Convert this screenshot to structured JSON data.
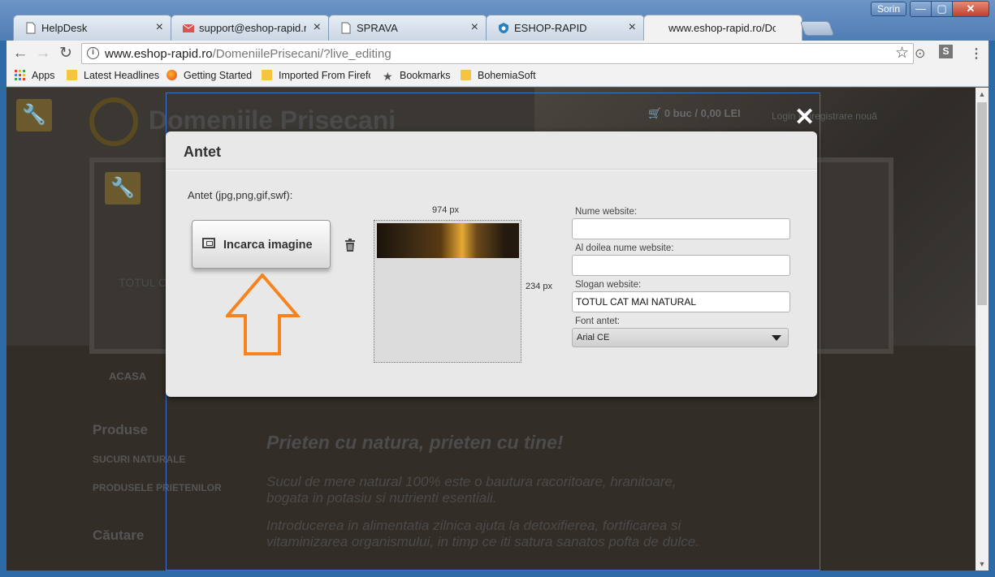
{
  "window": {
    "user": "Sorin",
    "min": "—",
    "max": "▢",
    "close": "✕"
  },
  "tabs": [
    {
      "title": "HelpDesk",
      "icon": "page-icon"
    },
    {
      "title": "support@eshop-rapid.ro",
      "icon": "mail-icon"
    },
    {
      "title": "SPRAVA",
      "icon": "page-icon"
    },
    {
      "title": "ESHOP-RAPID",
      "icon": "shield-icon"
    },
    {
      "title": "www.eshop-rapid.ro/Dom",
      "icon": "none",
      "active": true
    }
  ],
  "omnibox": {
    "domain": "www.eshop-rapid.ro",
    "path": "/DomeniilePrisecani/?live_editing"
  },
  "bookmarks": [
    {
      "label": "Apps",
      "icon": "apps-grid-icon"
    },
    {
      "label": "Latest Headlines",
      "icon": "folder-icon"
    },
    {
      "label": "Getting Started",
      "icon": "firefox-icon"
    },
    {
      "label": "Imported From Firefo",
      "icon": "folder-icon"
    },
    {
      "label": "Bookmarks",
      "icon": "star-icon"
    },
    {
      "label": "BohemiaSoft",
      "icon": "folder-icon"
    }
  ],
  "site": {
    "logo": "Domeniile Prisecani",
    "cart": "0 buc / 0,00 LEI",
    "login": "Login | Înregistrare nouă",
    "slogan": "TOTUL C",
    "nav_home": "ACASA",
    "sidebar_products": "Produse",
    "sidebar_item1": "SUCURI NATURALE",
    "sidebar_item2": "PRODUSELE PRIETENILOR",
    "sidebar_search": "Căutare",
    "headline": "Prieten cu natura, prieten cu tine!",
    "para1": "Sucul de mere natural 100% este o bautura racoritoare, hranitoare, bogata in potasiu si nutrienti esentiali.",
    "para2": "Introducerea in alimentatia zilnica ajuta la detoxifierea, fortificarea si vitaminizarea organismului, in timp ce iti satura sanatos pofta de dulce."
  },
  "dialog": {
    "title": "Antet",
    "file_label": "Antet (jpg,png,gif,swf):",
    "upload_button": "Incarca imagine",
    "width_label": "974 px",
    "height_label": "234 px",
    "fields": {
      "name_label": "Nume website:",
      "name_value": "",
      "second_name_label": "Al doilea nume website:",
      "second_name_value": "",
      "slogan_label": "Slogan website:",
      "slogan_value": "TOTUL CAT MAI NATURAL",
      "font_label": "Font antet:",
      "font_value": "Arial CE"
    },
    "arrow_color": "#f7831e"
  }
}
